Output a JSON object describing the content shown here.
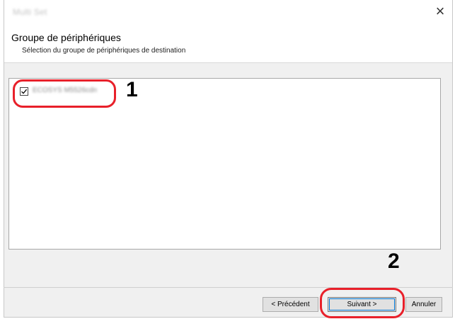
{
  "window": {
    "title": "Multi Set",
    "close_glyph": "×"
  },
  "header": {
    "title": "Groupe de périphériques",
    "subtitle": "Sélection du groupe de périphériques de destination"
  },
  "device_groups": [
    {
      "label": "ECOSYS M5526cdn",
      "checked": true
    }
  ],
  "callouts": {
    "step1": "1",
    "step2": "2"
  },
  "buttons": {
    "previous": "< Précédent",
    "next": "Suivant >",
    "cancel": "Annuler"
  },
  "colors": {
    "highlight": "#e8202a",
    "focus": "#0078d7"
  },
  "icons": {
    "checkbox": "checkbox-checked-icon",
    "close": "close-icon"
  }
}
